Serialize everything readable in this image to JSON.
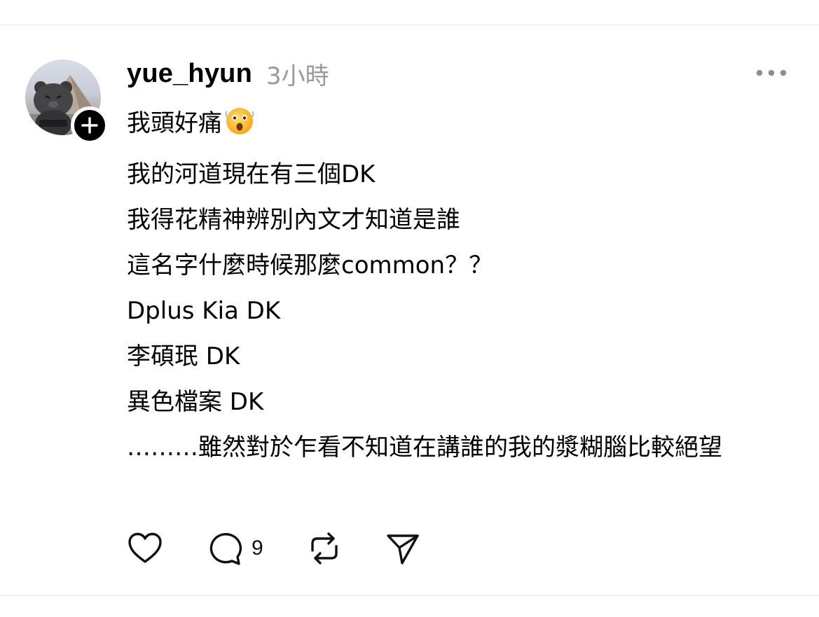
{
  "post": {
    "author": {
      "username": "yue_hyun",
      "avatar_icon": "bear-avatar-icon",
      "follow_icon": "plus-icon"
    },
    "timestamp": "3小時",
    "more_icon": "more-horizontal-icon",
    "body": {
      "line1_text": "我頭好痛",
      "line1_emoji": "astonished-face-emoji-icon",
      "line2": "我的河道現在有三個DK",
      "line3": "我得花精神辨別內文才知道是誰",
      "line4": "這名字什麼時候那麼common？？",
      "line5": "Dplus Kia DK",
      "line6": "李碩珉 DK",
      "line7": "異色檔案 DK",
      "line8": "………雖然對於乍看不知道在講誰的我的漿糊腦比較絕望"
    },
    "actions": {
      "like_icon": "heart-icon",
      "reply_icon": "comment-icon",
      "reply_count": "9",
      "repost_icon": "repost-icon",
      "share_icon": "send-icon"
    }
  }
}
